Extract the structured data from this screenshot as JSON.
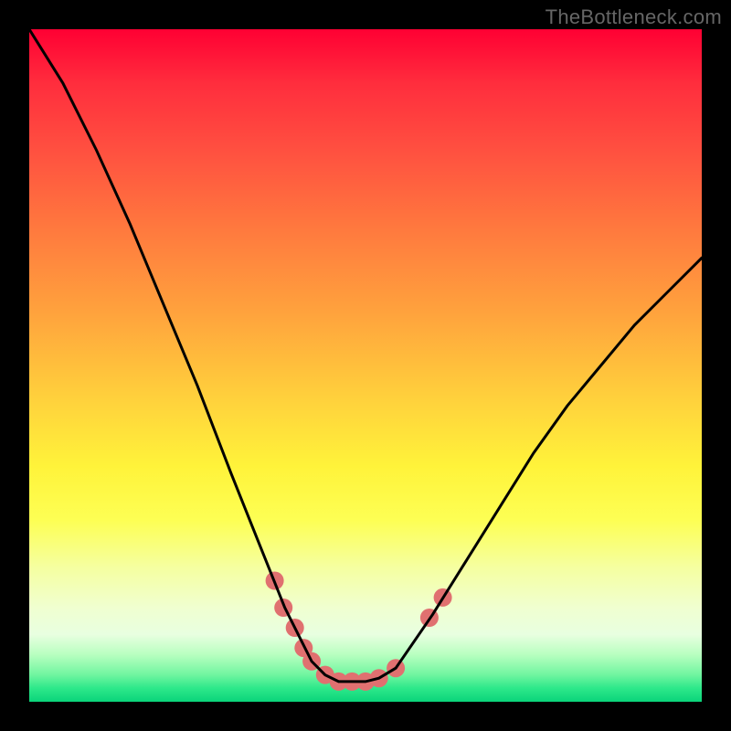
{
  "watermark": "TheBottleneck.com",
  "chart_data": {
    "type": "line",
    "title": "",
    "xlabel": "",
    "ylabel": "",
    "x_range": [
      0,
      1
    ],
    "y_range": [
      0,
      1
    ],
    "series": [
      {
        "name": "bottleneck-curve",
        "color": "#000000",
        "stroke_width": 3,
        "x": [
          0.0,
          0.05,
          0.1,
          0.15,
          0.2,
          0.25,
          0.3,
          0.34,
          0.38,
          0.4,
          0.42,
          0.44,
          0.46,
          0.48,
          0.5,
          0.52,
          0.545,
          0.6,
          0.65,
          0.7,
          0.75,
          0.8,
          0.85,
          0.9,
          0.95,
          1.0
        ],
        "values": [
          1.0,
          0.92,
          0.82,
          0.71,
          0.59,
          0.47,
          0.34,
          0.24,
          0.14,
          0.1,
          0.06,
          0.04,
          0.03,
          0.03,
          0.03,
          0.035,
          0.05,
          0.13,
          0.21,
          0.29,
          0.37,
          0.44,
          0.5,
          0.56,
          0.61,
          0.66
        ]
      },
      {
        "name": "highlight-markers",
        "color": "#e07070",
        "marker_radius": 10,
        "points": [
          {
            "x": 0.365,
            "y": 0.18
          },
          {
            "x": 0.378,
            "y": 0.14
          },
          {
            "x": 0.395,
            "y": 0.11
          },
          {
            "x": 0.408,
            "y": 0.08
          },
          {
            "x": 0.42,
            "y": 0.06
          },
          {
            "x": 0.44,
            "y": 0.04
          },
          {
            "x": 0.46,
            "y": 0.03
          },
          {
            "x": 0.48,
            "y": 0.03
          },
          {
            "x": 0.5,
            "y": 0.03
          },
          {
            "x": 0.52,
            "y": 0.035
          },
          {
            "x": 0.545,
            "y": 0.05
          },
          {
            "x": 0.595,
            "y": 0.125
          },
          {
            "x": 0.615,
            "y": 0.155
          }
        ]
      }
    ],
    "background_gradient": {
      "orientation": "vertical",
      "stops": [
        {
          "pos": 0.0,
          "color": "#ff0033"
        },
        {
          "pos": 0.3,
          "color": "#ff7a3e"
        },
        {
          "pos": 0.65,
          "color": "#fff33a"
        },
        {
          "pos": 0.9,
          "color": "#e8ffe0"
        },
        {
          "pos": 1.0,
          "color": "#0ad47a"
        }
      ]
    }
  }
}
